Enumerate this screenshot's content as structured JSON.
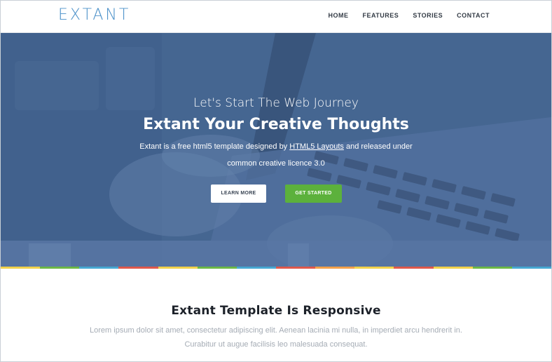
{
  "header": {
    "logo": "EXTANT",
    "nav": [
      "HOME",
      "FEATURES",
      "STORIES",
      "CONTACT"
    ]
  },
  "hero": {
    "tagline": "Let's Start The Web Journey",
    "title": "Extant Your Creative Thoughts",
    "desc_before": "Extant is a free html5 template designed by ",
    "desc_link": "HTML5 Layouts",
    "desc_after": " and released under common creative licence 3.0",
    "learn_more": "LEARN MORE",
    "get_started": "GET STARTED"
  },
  "strip_colors": [
    "#f2d24b",
    "#6cb845",
    "#46a8d2",
    "#e0584b",
    "#f2d24b",
    "#6cb845",
    "#46a8d2",
    "#e0584b",
    "#f4a14a",
    "#f2d24b",
    "#e0584b",
    "#f2d24b",
    "#6cb845",
    "#46a8d2"
  ],
  "section": {
    "title": "Extant Template Is Responsive",
    "text": "Lorem ipsum dolor sit amet, consectetur adipiscing elit. Aenean lacinia mi nulla, in imperdiet arcu hendrerit in. Curabitur ut augue facilisis leo malesuada consequat."
  },
  "colors": {
    "logo": "#4a90c9",
    "hero_bg": "#4a6c98",
    "cta_green": "#5cb13c"
  }
}
